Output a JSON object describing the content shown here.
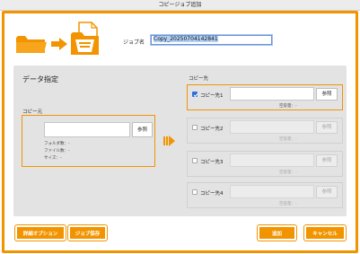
{
  "window": {
    "title": "コピージョブ追加"
  },
  "header": {
    "job_name_label": "ジョブ名",
    "job_name_value": "Copy_20250704142841"
  },
  "data_spec": {
    "title": "データ指定",
    "source_label": "コピー元",
    "browse_label": "参照",
    "folder_count": "フォルダ数：-",
    "file_count": "ファイル数：-",
    "size": "サイズ：-"
  },
  "destinations": {
    "title": "コピー先",
    "items": [
      {
        "label": "コピー先1",
        "checked": true,
        "browse": "参照",
        "capacity": "空容量：-"
      },
      {
        "label": "コピー先2",
        "checked": false,
        "browse": "参照",
        "capacity": "空容量：-"
      },
      {
        "label": "コピー先3",
        "checked": false,
        "browse": "参照",
        "capacity": "空容量：-"
      },
      {
        "label": "コピー先4",
        "checked": false,
        "browse": "参照",
        "capacity": "空容量：-"
      }
    ]
  },
  "footer": {
    "advanced_options": "詳細オプション",
    "save_job": "ジョブ保存",
    "add": "追加",
    "cancel": "キャンセル"
  },
  "colors": {
    "accent": "#f29400",
    "panel": "#e3e3e3",
    "checkbox": "#2f6fd8"
  },
  "icons": [
    "folder-icon",
    "arrow-right-icon",
    "copy-document-icon",
    "forward-arrow-icon",
    "checkmark-icon"
  ]
}
